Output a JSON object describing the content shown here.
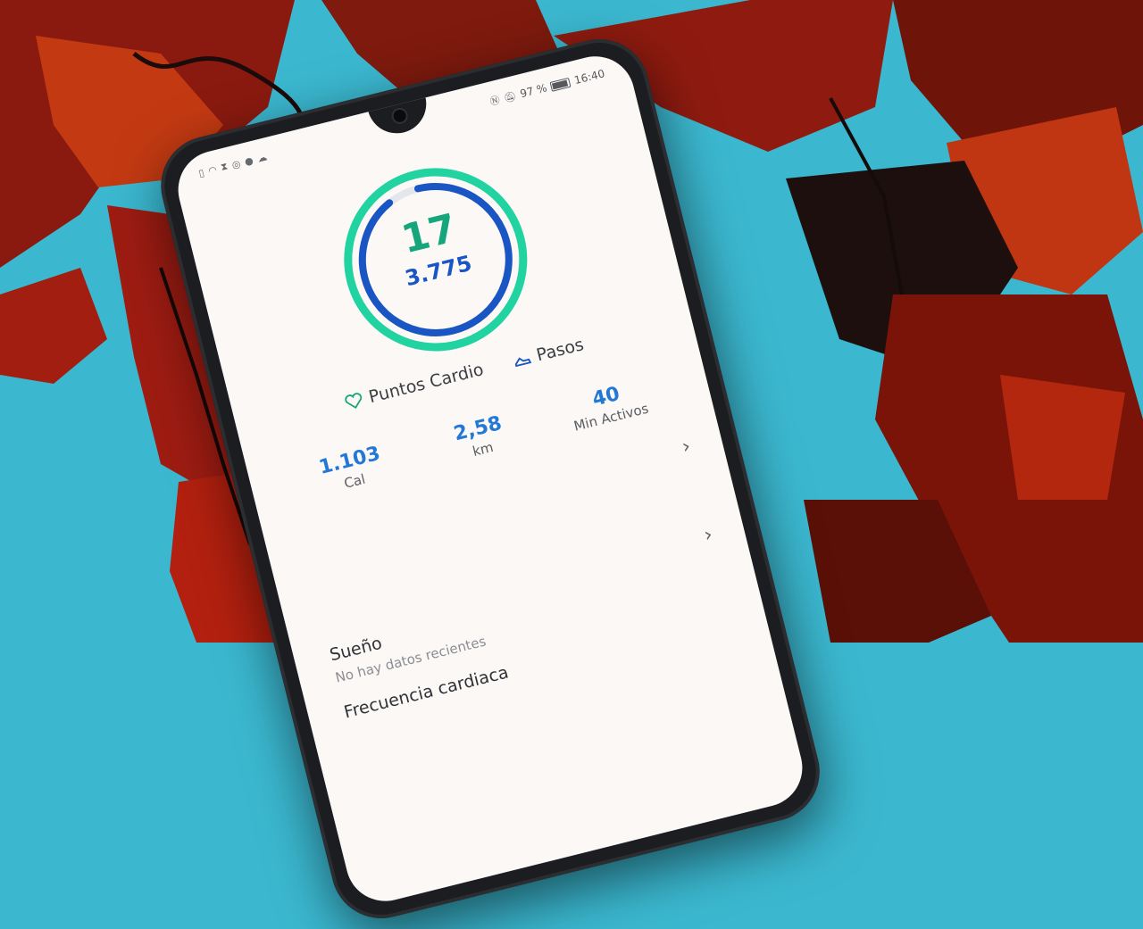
{
  "status_bar": {
    "battery_percent": "97 %",
    "time": "16:40"
  },
  "ring": {
    "cardio_points": "17",
    "steps": "3.775",
    "outer_progress": 1.0,
    "inner_progress": 0.93,
    "outer_color": "#21d3a0",
    "inner_color": "#1a55c4"
  },
  "legend": {
    "cardio_label": "Puntos Cardio",
    "steps_label": "Pasos",
    "cardio_icon": "heart-icon",
    "steps_icon": "shoes-icon"
  },
  "metrics": [
    {
      "value": "1.103",
      "unit": "Cal"
    },
    {
      "value": "2,58",
      "unit": "km"
    },
    {
      "value": "40",
      "unit": "Min Activos"
    }
  ],
  "sleep": {
    "title": "Sueño",
    "subtitle": "No hay datos recientes"
  },
  "heart_rate": {
    "title": "Frecuencia cardiaca"
  },
  "colors": {
    "accent_green": "#17a67b",
    "accent_blue": "#1a55c4",
    "metric_blue": "#2378d6"
  }
}
